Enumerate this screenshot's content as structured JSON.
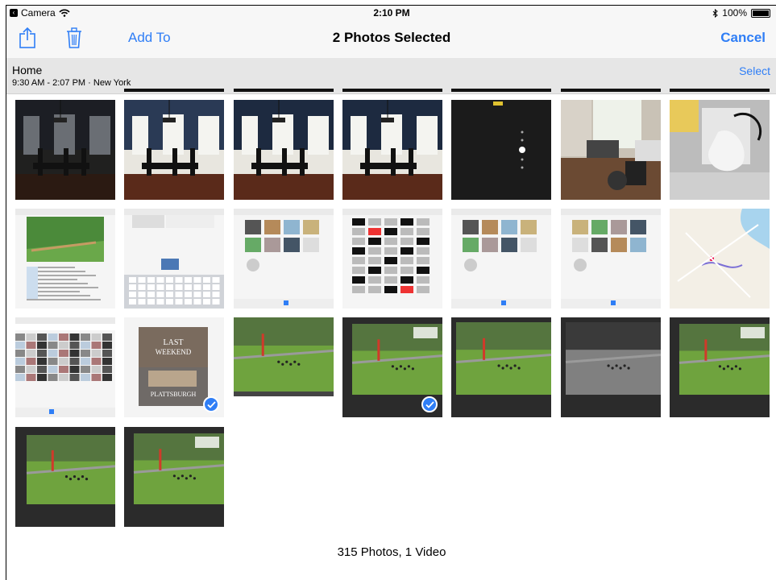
{
  "status_bar": {
    "carrier": "Camera",
    "time": "2:10 PM",
    "battery": "100%"
  },
  "navbar": {
    "add_to": "Add To",
    "title": "2 Photos Selected",
    "cancel": "Cancel"
  },
  "moment": {
    "place": "Home",
    "meta": "9:30 AM - 2:07 PM · New York",
    "select": "Select"
  },
  "grid": {
    "rows": [
      [
        {
          "kind": "dining-dark",
          "selected": false
        },
        {
          "kind": "dining-bright",
          "selected": false
        },
        {
          "kind": "dining",
          "selected": false
        },
        {
          "kind": "dining",
          "selected": false
        },
        {
          "kind": "camera-dark",
          "selected": false
        },
        {
          "kind": "office",
          "selected": false
        },
        {
          "kind": "desk",
          "selected": false
        }
      ],
      [
        {
          "kind": "screenshot-web",
          "selected": false
        },
        {
          "kind": "screenshot-keyboard",
          "selected": false
        },
        {
          "kind": "screenshot-photos",
          "selected": false
        },
        {
          "kind": "screenshot-grid",
          "selected": false
        },
        {
          "kind": "screenshot-photos",
          "selected": false
        },
        {
          "kind": "screenshot-album",
          "selected": false
        },
        {
          "kind": "screenshot-map",
          "selected": false
        }
      ],
      [
        {
          "kind": "screenshot-album-grid",
          "selected": false
        },
        {
          "kind": "last-weekend",
          "selected": true
        },
        {
          "kind": "lawn",
          "selected": false
        },
        {
          "kind": "lawn-edit",
          "selected": true
        },
        {
          "kind": "lawn-rotate",
          "selected": false
        },
        {
          "kind": "lawn-bw",
          "selected": false
        },
        {
          "kind": "lawn-edit2",
          "selected": false
        }
      ],
      [
        {
          "kind": "lawn-edit-dark",
          "selected": false
        },
        {
          "kind": "lawn-edit3",
          "selected": false
        }
      ]
    ]
  },
  "last_weekend": {
    "line1": "LAST",
    "line2": "WEEKEND",
    "place": "PLATTSBURGH"
  },
  "footer": "315 Photos, 1 Video",
  "colors": {
    "accent": "#2f7ef6",
    "bar_bg": "#f7f7f7",
    "header_bg": "#e6e6e6"
  },
  "icons": [
    "share-icon",
    "trash-icon",
    "wifi-icon",
    "bluetooth-icon",
    "battery-icon",
    "checkmark-icon"
  ]
}
